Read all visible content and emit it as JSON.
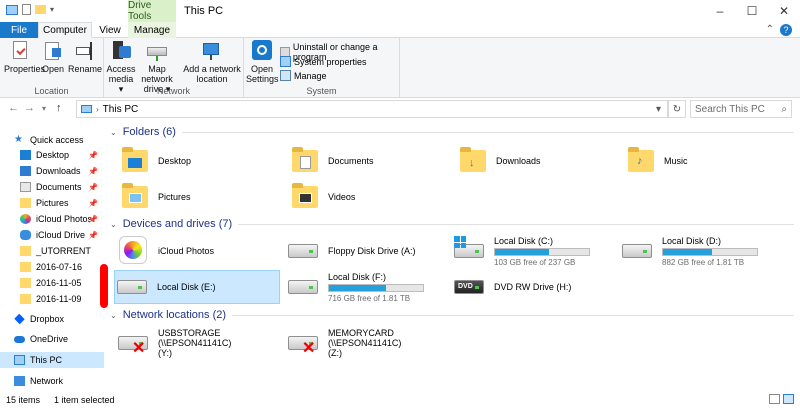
{
  "window": {
    "title": "This PC",
    "context_tab_title": "Drive Tools",
    "controls": [
      "–",
      "☐",
      "✕"
    ]
  },
  "tabs": [
    "File",
    "Computer",
    "View",
    "Manage"
  ],
  "ribbon": {
    "location_group": {
      "label": "Location",
      "buttons": [
        "Properties",
        "Open",
        "Rename"
      ]
    },
    "network_group": {
      "label": "Network",
      "buttons": [
        "Access media ▾",
        "Map network drive ▾",
        "Add a network location"
      ]
    },
    "system_group": {
      "label": "System",
      "big_button": "Open Settings",
      "small_buttons": [
        "Uninstall or change a program",
        "System properties",
        "Manage"
      ]
    }
  },
  "address": {
    "path": "This PC",
    "search_placeholder": "Search This PC"
  },
  "nav_pane": {
    "items": [
      {
        "label": "Quick access",
        "icon": "star-icon"
      },
      {
        "label": "Desktop",
        "icon": "desktop-icon",
        "pinned": true
      },
      {
        "label": "Downloads",
        "icon": "downloads-icon",
        "pinned": true
      },
      {
        "label": "Documents",
        "icon": "documents-icon",
        "pinned": true
      },
      {
        "label": "Pictures",
        "icon": "pictures-icon",
        "pinned": true
      },
      {
        "label": "iCloud Photos",
        "icon": "icloud-photos-icon",
        "pinned": true
      },
      {
        "label": "iCloud Drive",
        "icon": "icloud-drive-icon",
        "pinned": true
      },
      {
        "label": "_UTORRENT",
        "icon": "folder-icon"
      },
      {
        "label": "2016-07-16",
        "icon": "folder-icon"
      },
      {
        "label": "2016-11-05",
        "icon": "folder-icon"
      },
      {
        "label": "2016-11-09",
        "icon": "folder-icon"
      },
      {
        "label": "Dropbox",
        "icon": "dropbox-icon"
      },
      {
        "label": "OneDrive",
        "icon": "onedrive-icon"
      },
      {
        "label": "This PC",
        "icon": "this-pc-icon",
        "selected": true
      },
      {
        "label": "Network",
        "icon": "network-icon"
      }
    ]
  },
  "groups": {
    "folders": {
      "header": "Folders (6)",
      "items": [
        "Desktop",
        "Documents",
        "Downloads",
        "Music",
        "Pictures",
        "Videos"
      ]
    },
    "devices": {
      "header": "Devices and drives (7)",
      "items": [
        {
          "name": "iCloud Photos"
        },
        {
          "name": "Floppy Disk Drive (A:)"
        },
        {
          "name": "Local Disk (C:)",
          "free": "103 GB free of 237 GB",
          "used_fraction": 0.57
        },
        {
          "name": "Local Disk (D:)",
          "free": "882 GB free of 1.81 TB",
          "used_fraction": 0.52
        },
        {
          "name": "Local Disk (E:)",
          "selected": true
        },
        {
          "name": "Local Disk (F:)",
          "free": "716 GB free of 1.81 TB",
          "used_fraction": 0.61
        },
        {
          "name": "DVD RW Drive (H:)"
        }
      ]
    },
    "network": {
      "header": "Network locations (2)",
      "items": [
        {
          "name": "USBSTORAGE (\\\\EPSON41141C)",
          "letter": "(Y:)"
        },
        {
          "name": "MEMORYCARD (\\\\EPSON41141C)",
          "letter": "(Z:)"
        }
      ]
    }
  },
  "status": {
    "count": "15 items",
    "selection": "1 item selected"
  },
  "colors": {
    "accent": "#1979ca",
    "selection": "#cce8ff",
    "bar_fill": "#26a0da",
    "group_header": "#1e3287"
  }
}
